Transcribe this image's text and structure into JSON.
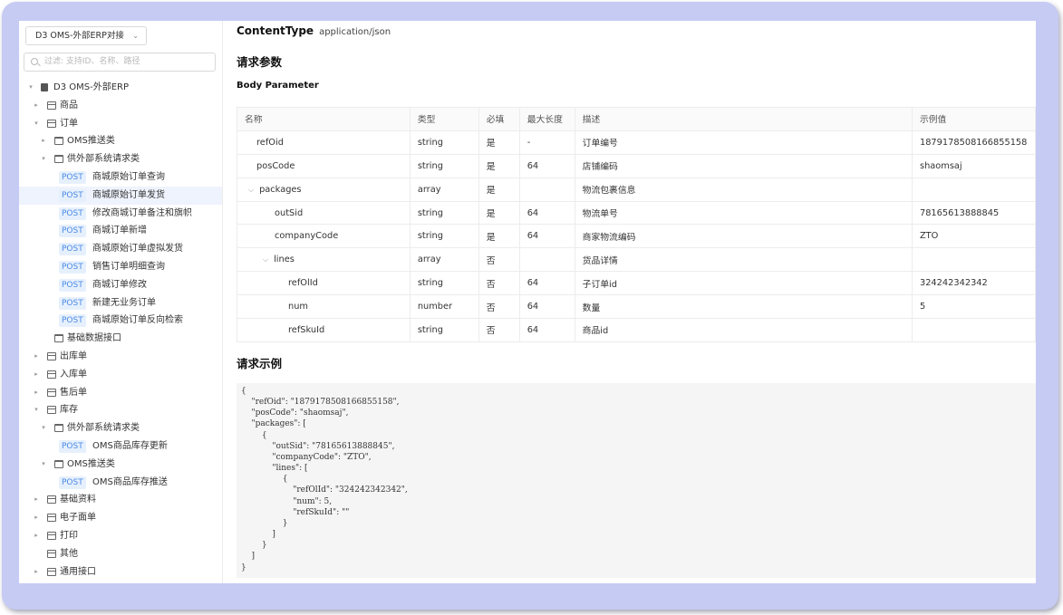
{
  "project_selector": {
    "label": "D3 OMS-外部ERP对接",
    "icon": "chevron-down-icon"
  },
  "search": {
    "placeholder": "过滤: 支持ID、名称、路径"
  },
  "tree": [
    {
      "label": "D3 OMS-外部ERP",
      "type": "root",
      "depth": 0,
      "expand": "open"
    },
    {
      "label": "商品",
      "type": "box",
      "depth": 1,
      "expand": "closed"
    },
    {
      "label": "订单",
      "type": "box",
      "depth": 1,
      "expand": "open"
    },
    {
      "label": "OMS推送类",
      "type": "folder",
      "depth": 2,
      "expand": "closed"
    },
    {
      "label": "供外部系统请求类",
      "type": "folder",
      "depth": 2,
      "expand": "open"
    },
    {
      "label": "商城原始订单查询",
      "type": "api",
      "method": "POST",
      "depth": 3
    },
    {
      "label": "商城原始订单发货",
      "type": "api",
      "method": "POST",
      "depth": 3,
      "active": true
    },
    {
      "label": "修改商城订单备注和旗帜",
      "type": "api",
      "method": "POST",
      "depth": 3
    },
    {
      "label": "商城订单新增",
      "type": "api",
      "method": "POST",
      "depth": 3
    },
    {
      "label": "商城原始订单虚拟发货",
      "type": "api",
      "method": "POST",
      "depth": 3
    },
    {
      "label": "销售订单明细查询",
      "type": "api",
      "method": "POST",
      "depth": 3
    },
    {
      "label": "商城订单修改",
      "type": "api",
      "method": "POST",
      "depth": 3
    },
    {
      "label": "新建无业务订单",
      "type": "api",
      "method": "POST",
      "depth": 3
    },
    {
      "label": "商城原始订单反向检索",
      "type": "api",
      "method": "POST",
      "depth": 3
    },
    {
      "label": "基础数据接口",
      "type": "folder",
      "depth": 2,
      "expand": "none"
    },
    {
      "label": "出库单",
      "type": "box",
      "depth": 1,
      "expand": "closed"
    },
    {
      "label": "入库单",
      "type": "box",
      "depth": 1,
      "expand": "closed"
    },
    {
      "label": "售后单",
      "type": "box",
      "depth": 1,
      "expand": "closed"
    },
    {
      "label": "库存",
      "type": "box",
      "depth": 1,
      "expand": "open"
    },
    {
      "label": "供外部系统请求类",
      "type": "folder",
      "depth": 2,
      "expand": "open"
    },
    {
      "label": "OMS商品库存更新",
      "type": "api",
      "method": "POST",
      "depth": 3
    },
    {
      "label": "OMS推送类",
      "type": "folder",
      "depth": 2,
      "expand": "open"
    },
    {
      "label": "OMS商品库存推送",
      "type": "api",
      "method": "POST",
      "depth": 3
    },
    {
      "label": "基础资料",
      "type": "box",
      "depth": 1,
      "expand": "closed"
    },
    {
      "label": "电子面单",
      "type": "box",
      "depth": 1,
      "expand": "closed"
    },
    {
      "label": "打印",
      "type": "box",
      "depth": 1,
      "expand": "closed"
    },
    {
      "label": "其他",
      "type": "box",
      "depth": 1,
      "expand": "none"
    },
    {
      "label": "通用接口",
      "type": "box",
      "depth": 1,
      "expand": "closed"
    }
  ],
  "content_type": {
    "label": "ContentType",
    "value": "application/json"
  },
  "request_params_title": "请求参数",
  "body_parameter_title": "Body Parameter",
  "table": {
    "headers": [
      "名称",
      "类型",
      "必填",
      "最大长度",
      "描述",
      "示例值"
    ],
    "rows": [
      {
        "name": "refOid",
        "type": "string",
        "required": "是",
        "max": "-",
        "desc": "订单编号",
        "example": "1879178508166855158",
        "level": 1,
        "toggle": ""
      },
      {
        "name": "posCode",
        "type": "string",
        "required": "是",
        "max": "64",
        "desc": "店铺编码",
        "example": "shaomsaj",
        "level": 1,
        "toggle": ""
      },
      {
        "name": "packages",
        "type": "array",
        "required": "是",
        "max": "",
        "desc": "物流包裹信息",
        "example": "",
        "level": 1,
        "toggle": "open"
      },
      {
        "name": "outSid",
        "type": "string",
        "required": "是",
        "max": "64",
        "desc": "物流单号",
        "example": "78165613888845",
        "level": 2,
        "toggle": ""
      },
      {
        "name": "companyCode",
        "type": "string",
        "required": "是",
        "max": "64",
        "desc": "商家物流编码",
        "example": "ZTO",
        "level": 2,
        "toggle": ""
      },
      {
        "name": "lines",
        "type": "array",
        "required": "否",
        "max": "",
        "desc": "货品详情",
        "example": "",
        "level": 2,
        "toggle": "open"
      },
      {
        "name": "refOlId",
        "type": "string",
        "required": "否",
        "max": "64",
        "desc": "子订单id",
        "example": "324242342342",
        "level": 3,
        "toggle": ""
      },
      {
        "name": "num",
        "type": "number",
        "required": "否",
        "max": "64",
        "desc": "数量",
        "example": "5",
        "level": 3,
        "toggle": ""
      },
      {
        "name": "refSkuId",
        "type": "string",
        "required": "否",
        "max": "64",
        "desc": "商品id",
        "example": "",
        "level": 3,
        "toggle": ""
      }
    ]
  },
  "request_example_title": "请求示例",
  "request_example_code": "{\n    \"refOid\": \"1879178508166855158\",\n    \"posCode\": \"shaomsaj\",\n    \"packages\": [\n        {\n            \"outSid\": \"78165613888845\",\n            \"companyCode\": \"ZTO\",\n            \"lines\": [\n                {\n                    \"refOlId\": \"324242342342\",\n                    \"num\": 5,\n                    \"refSkuId\": \"\"\n                }\n            ]\n        }\n    ]\n}",
  "colors": {
    "accent": "#4a8ae6",
    "required": "#e8463d",
    "frame": "#c6cbf4",
    "active_row": "#eef3fd"
  }
}
